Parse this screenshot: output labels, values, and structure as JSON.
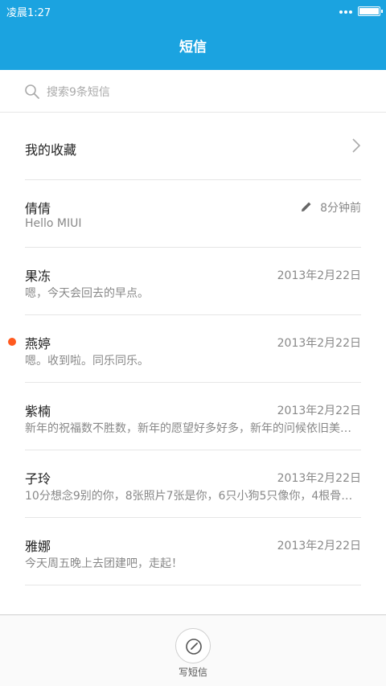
{
  "status_bar": {
    "time": "凌晨1:27"
  },
  "header": {
    "title": "短信"
  },
  "search": {
    "placeholder": "搜索9条短信"
  },
  "favorites": {
    "label": "我的收藏"
  },
  "messages": [
    {
      "name": "倩倩",
      "preview": "Hello MIUI",
      "time": "8分钟前",
      "unread": false,
      "draft": true
    },
    {
      "name": "果冻",
      "preview": "嗯，今天会回去的早点。",
      "time": "2013年2月22日",
      "unread": false,
      "draft": false
    },
    {
      "name": "燕婷",
      "preview": "嗯。收到啦。同乐同乐。",
      "time": "2013年2月22日",
      "unread": true,
      "draft": false
    },
    {
      "name": "紫楠",
      "preview": "新年的祝福数不胜数，新年的愿望好多好多，新年的问候依旧美…",
      "time": "2013年2月22日",
      "unread": false,
      "draft": false
    },
    {
      "name": "子玲",
      "preview": "10分想念9别的你，8张照片7张是你，6只小狗5只像你，4根骨…",
      "time": "2013年2月22日",
      "unread": false,
      "draft": false
    },
    {
      "name": "雅娜",
      "preview": "今天周五晚上去团建吧，走起！",
      "time": "2013年2月22日",
      "unread": false,
      "draft": false
    }
  ],
  "bottom": {
    "compose_label": "写短信"
  },
  "colors": {
    "header": "#1ba3e0",
    "unread_dot": "#ff5a1f"
  }
}
